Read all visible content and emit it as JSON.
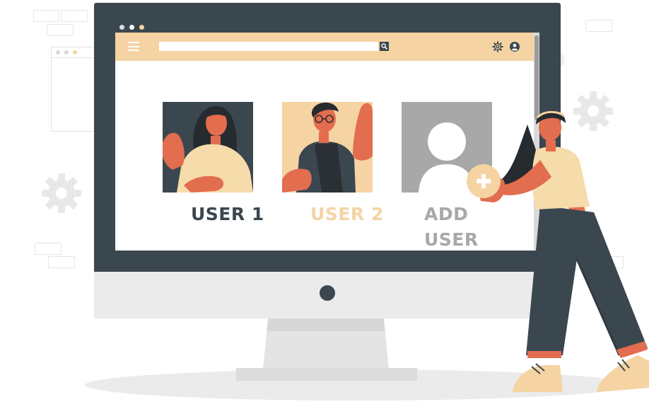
{
  "search": {
    "placeholder": "",
    "value": ""
  },
  "users": [
    {
      "label": "USER 1",
      "color": "#3b474f"
    },
    {
      "label": "USER 2",
      "color": "#f5d3a3"
    }
  ],
  "add_user": {
    "line1": "ADD",
    "line2": "USER",
    "color": "#a8a8a8"
  },
  "colors": {
    "monitor": "#3b474f",
    "accent": "#f5d3a3",
    "skin": "#e26d4f",
    "placeholder_gray": "#a8a8a8"
  },
  "icons": {
    "menu": "hamburger-menu-icon",
    "search": "magnifier-icon",
    "settings": "gear-icon",
    "profile": "user-avatar-icon",
    "add": "plus-icon"
  }
}
